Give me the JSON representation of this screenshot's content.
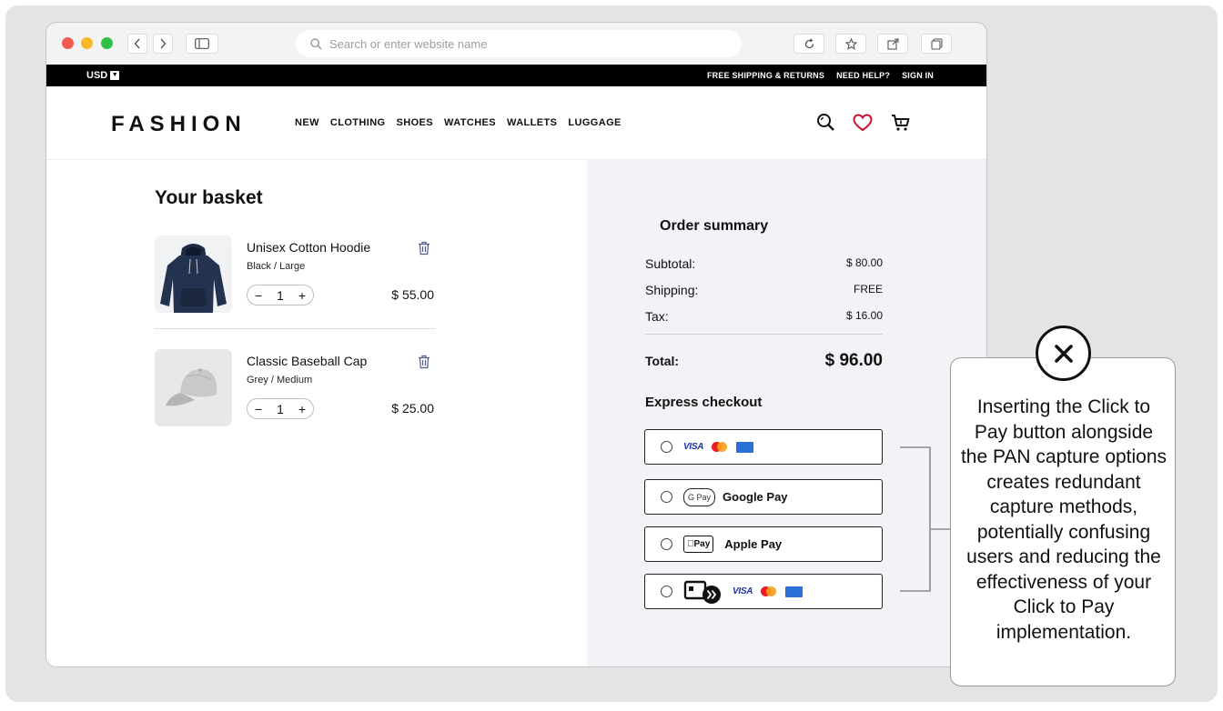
{
  "browser": {
    "url_placeholder": "Search or enter website name"
  },
  "topbar": {
    "currency": "USD",
    "links": [
      "FREE SHIPPING & RETURNS",
      "NEED HELP?",
      "SIGN IN"
    ]
  },
  "header": {
    "logo": "FASHION",
    "nav": [
      "NEW",
      "CLOTHING",
      "SHOES",
      "WATCHES",
      "WALLETS",
      "LUGGAGE"
    ],
    "icons": [
      "search-icon",
      "heart-icon",
      "cart-icon"
    ],
    "heart_color": "#c8102e"
  },
  "basket": {
    "title": "Your basket",
    "items": [
      {
        "name": "Unisex Cotton Hoodie",
        "variant": "Black / Large",
        "qty": "1",
        "price": "$ 55.00",
        "minus": "−",
        "plus": "+"
      },
      {
        "name": "Classic Baseball Cap",
        "variant": "Grey / Medium",
        "qty": "1",
        "price": "$ 25.00",
        "minus": "−",
        "plus": "+"
      }
    ]
  },
  "summary": {
    "title": "Order summary",
    "subtotal_label": "Subtotal:",
    "subtotal": "$ 80.00",
    "shipping_label": "Shipping:",
    "shipping": "FREE",
    "tax_label": "Tax:",
    "tax": "$ 16.00",
    "total_label": "Total:",
    "total": "$ 96.00",
    "express_title": "Express checkout",
    "options": [
      {
        "type": "cards",
        "visa": "VISA"
      },
      {
        "type": "google-pay",
        "badge": "G Pay",
        "label": "Google Pay"
      },
      {
        "type": "apple-pay",
        "badge": "Pay",
        "label": "Apple Pay"
      },
      {
        "type": "click-to-pay",
        "visa": "VISA"
      }
    ]
  },
  "callout": {
    "text": "Inserting the Click to Pay button alongside the PAN capture options creates redundant capture methods, potentially confusing users and reducing the effectiveness of your Click to Pay implementation.",
    "icon": "close-x-icon"
  }
}
